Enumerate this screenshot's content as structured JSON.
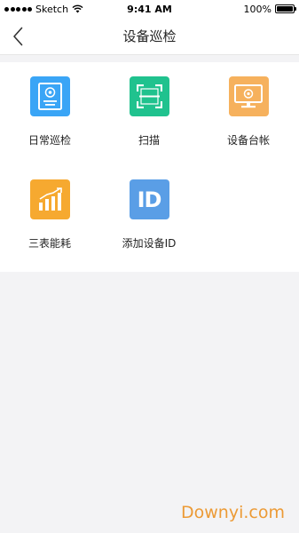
{
  "status_bar": {
    "carrier": "Sketch",
    "time": "9:41 AM",
    "battery": "100%"
  },
  "nav": {
    "title": "设备巡检",
    "back_icon": "chevron-left-icon"
  },
  "tiles": [
    {
      "label": "日常巡检",
      "icon": "passport-document-icon",
      "color": "#3aa5f6"
    },
    {
      "label": "扫描",
      "icon": "scan-frame-icon",
      "color": "#20c28e"
    },
    {
      "label": "设备台帐",
      "icon": "monitor-icon",
      "color": "#f6b15d"
    },
    {
      "label": "三表能耗",
      "icon": "bar-chart-icon",
      "color": "#f6a930"
    },
    {
      "label": "添加设备ID",
      "icon": "id-icon",
      "icon_text": "ID",
      "color": "#5a9ee6"
    }
  ],
  "watermark": "Downyi.com"
}
